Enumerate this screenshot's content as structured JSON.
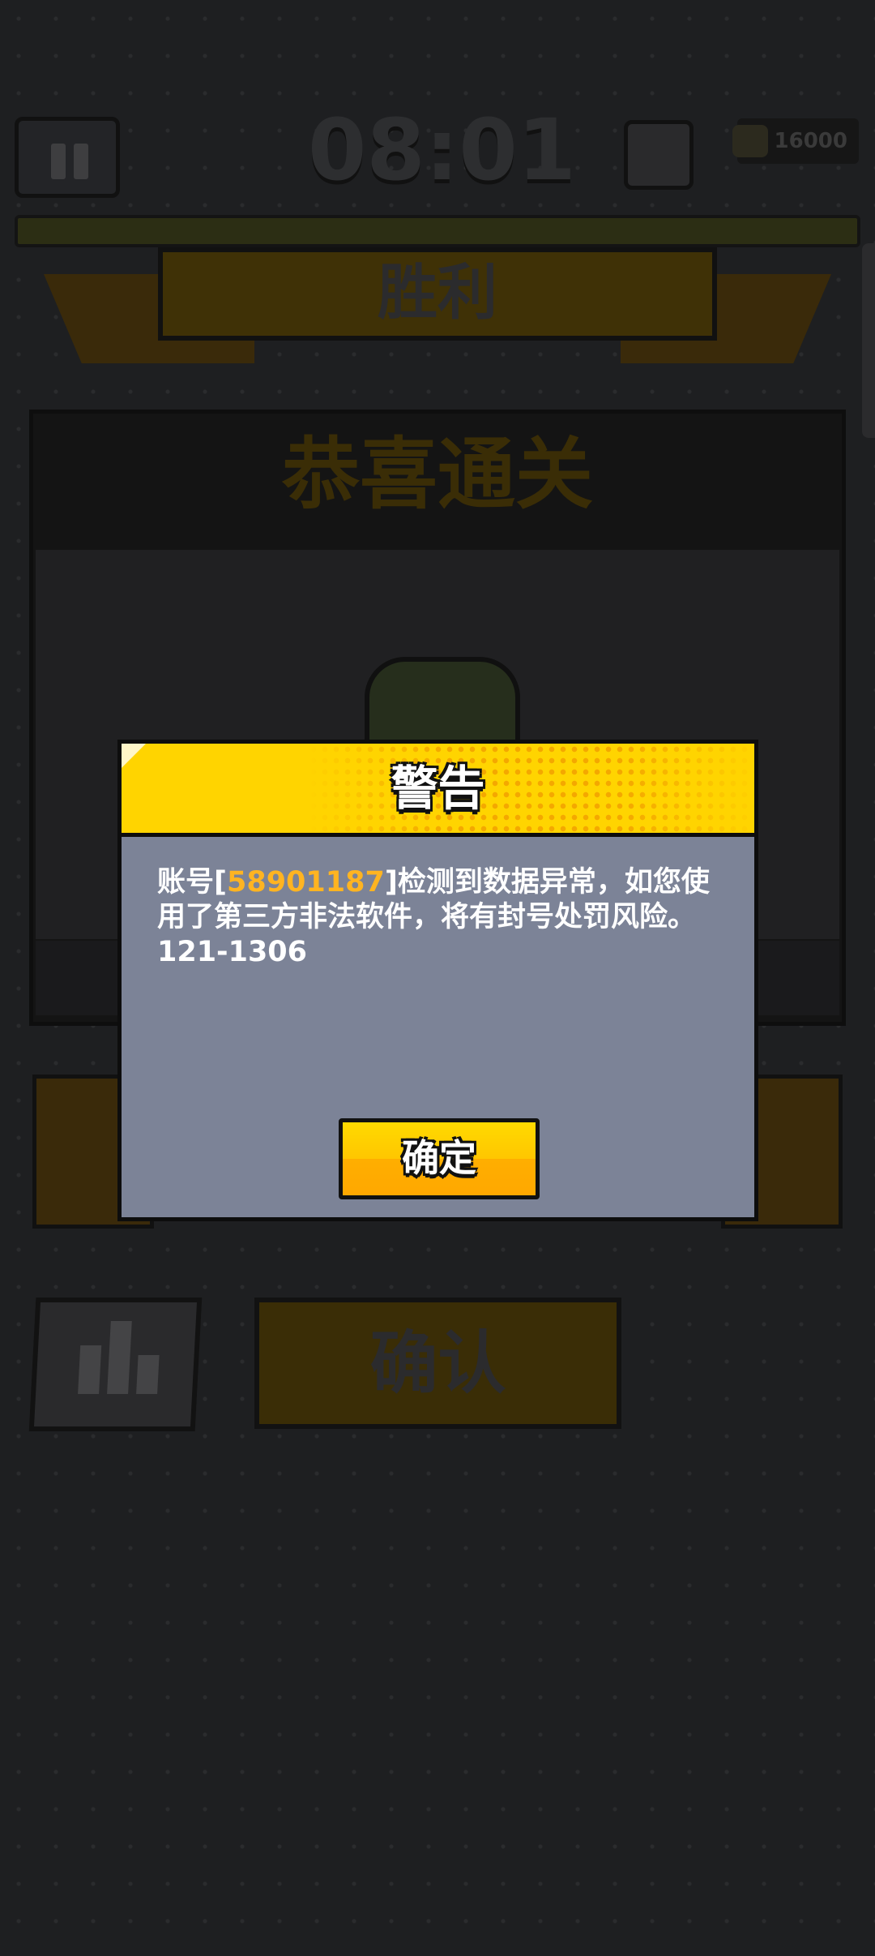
{
  "hud": {
    "timer": "08:01",
    "coins": "16000"
  },
  "result": {
    "banner": "胜利",
    "title": "恭喜通关",
    "confirm_label": "确认"
  },
  "dialog": {
    "title": "警告",
    "message_prefix": "账号[",
    "account_id": "58901187",
    "message_suffix": "]检测到数据异常，如您使用了第三方非法软件，将有封号处罚风险。",
    "code": "121-1306",
    "ok_label": "确定"
  },
  "colors": {
    "dialog_header": "#ffd400",
    "dialog_body": "#7c8397",
    "account_id": "#ffb421",
    "ok_button": "#ffc600"
  }
}
